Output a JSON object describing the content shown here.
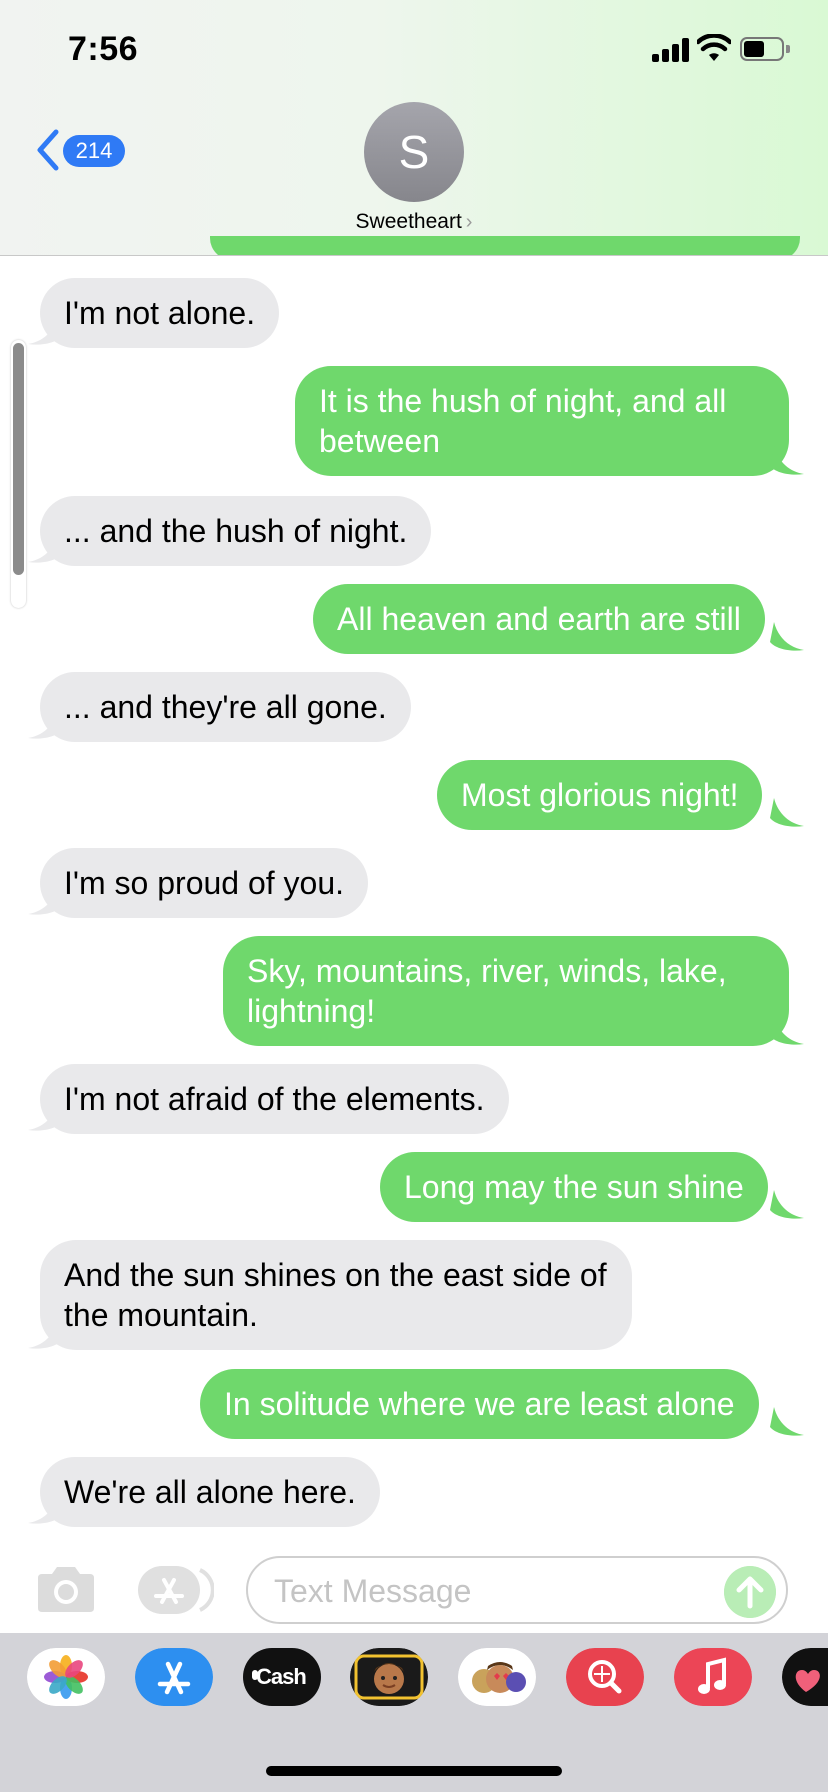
{
  "status_bar": {
    "time": "7:56"
  },
  "header": {
    "back_badge": "214",
    "avatar_initial": "S",
    "contact_name": "Sweetheart"
  },
  "messages": [
    {
      "from": "them",
      "text": "I'm not alone."
    },
    {
      "from": "me",
      "text": "It is the hush of night, and all between"
    },
    {
      "from": "them",
      "text": "... and the hush of night."
    },
    {
      "from": "me",
      "text": "All heaven and earth are still"
    },
    {
      "from": "them",
      "text": "... and they're all gone."
    },
    {
      "from": "me",
      "text": "Most glorious night!"
    },
    {
      "from": "them",
      "text": "I'm so proud of you."
    },
    {
      "from": "me",
      "text": "Sky, mountains, river, winds, lake, lightning!"
    },
    {
      "from": "them",
      "text": "I'm not afraid of the elements."
    },
    {
      "from": "me",
      "text": "Long may the sun shine"
    },
    {
      "from": "them",
      "text": "And the sun shines on the east side of the mountain."
    },
    {
      "from": "me",
      "text": "In solitude where we are least alone"
    },
    {
      "from": "them",
      "text": "We're all alone here."
    }
  ],
  "composer": {
    "placeholder": "Text Message"
  },
  "app_tray": [
    {
      "name": "Photos",
      "icon": "photos-icon"
    },
    {
      "name": "App Store",
      "icon": "app-store-icon"
    },
    {
      "name": "Cash",
      "label": "Cash",
      "icon": "apple-cash-icon"
    },
    {
      "name": "Memoji",
      "icon": "memoji-icon"
    },
    {
      "name": "Memoji Stickers",
      "icon": "memoji-stickers-icon"
    },
    {
      "name": "Search Images",
      "icon": "image-search-icon"
    },
    {
      "name": "Music",
      "icon": "music-icon"
    },
    {
      "name": "Digital Touch",
      "icon": "digital-touch-icon"
    }
  ],
  "colors": {
    "sent_bubble": "#6fd86c",
    "received_bubble": "#e9e9eb",
    "badge_blue": "#2f7af5"
  }
}
